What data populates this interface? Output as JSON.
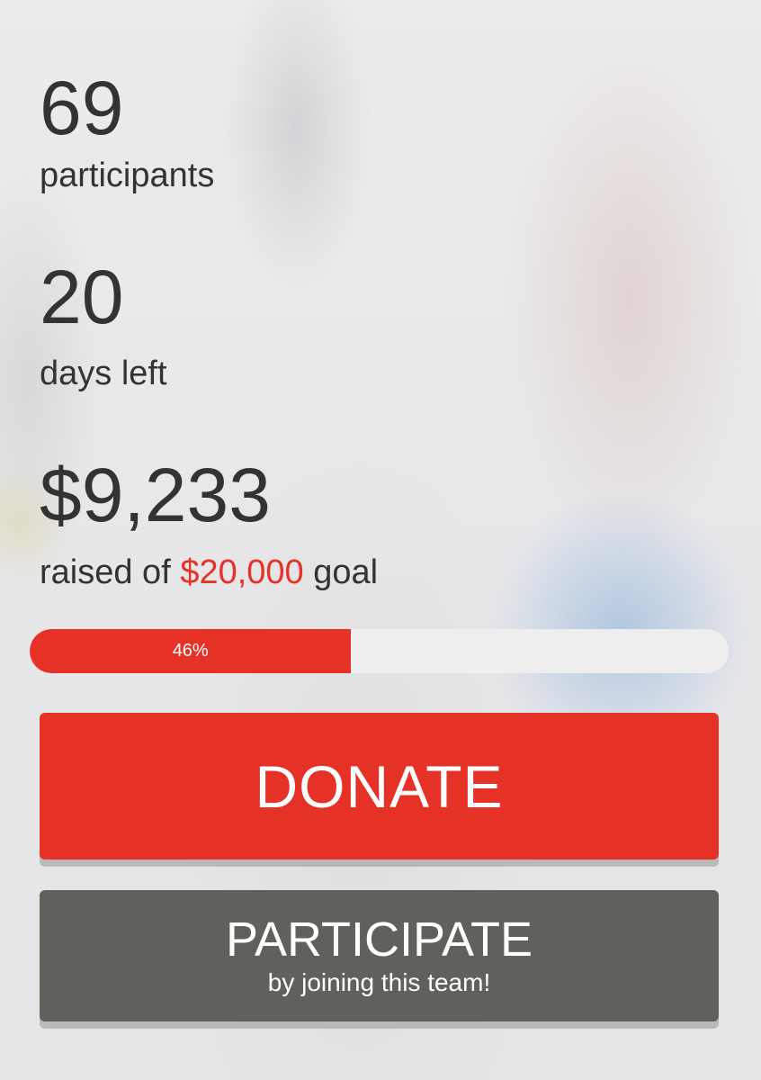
{
  "stats": {
    "participants": {
      "value": "69",
      "label": "participants"
    },
    "days": {
      "value": "20",
      "label": "days left"
    },
    "raised": {
      "value": "$9,233",
      "label_prefix": "raised of ",
      "goal": "$20,000",
      "label_suffix": " goal"
    }
  },
  "progress": {
    "percent": 46,
    "label": "46%"
  },
  "buttons": {
    "donate": {
      "label": "DONATE"
    },
    "participate": {
      "label": "PARTICIPATE",
      "sublabel": "by joining this team!"
    }
  },
  "colors": {
    "accent": "#e63226",
    "text": "#333333",
    "secondary_button": "#61605b",
    "progress_track": "#efeeef"
  }
}
